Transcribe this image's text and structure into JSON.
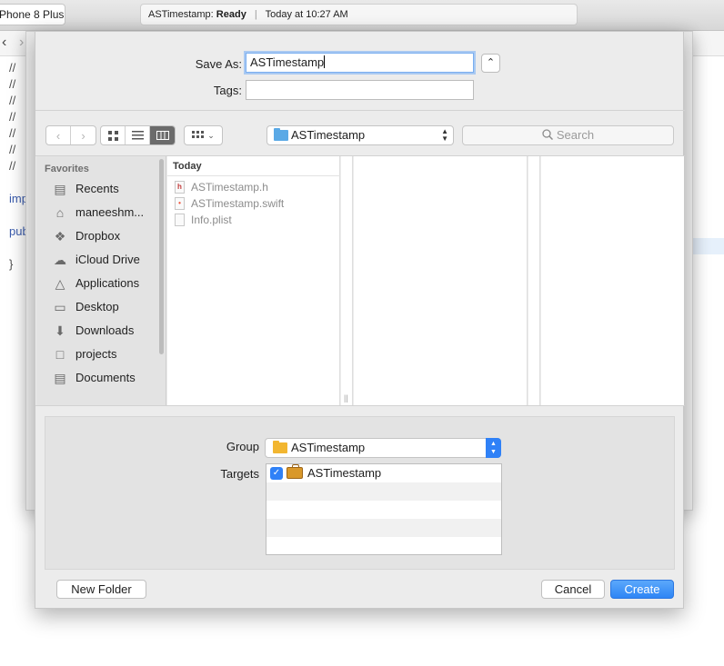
{
  "xcode": {
    "scheme": "Phone 8 Plus",
    "activity_name": "ASTimestamp:",
    "activity_status": "Ready",
    "activity_time": "Today at 10:27 AM",
    "code_lines": [
      "//",
      "//",
      "//",
      "//",
      "//",
      "//",
      "//",
      "imp",
      "pub",
      "}"
    ]
  },
  "save_as": {
    "label": "Save As:",
    "value": "ASTimestamp"
  },
  "tags": {
    "label": "Tags:",
    "value": ""
  },
  "location_popup": {
    "value": "ASTimestamp",
    "icon": "folder-icon"
  },
  "search": {
    "placeholder": "Search",
    "icon": "magnifier-icon"
  },
  "sidebar": {
    "header": "Favorites",
    "items": [
      {
        "label": "Recents",
        "icon": "clock-icon"
      },
      {
        "label": "maneeshm...",
        "icon": "home-icon"
      },
      {
        "label": "Dropbox",
        "icon": "dropbox-icon"
      },
      {
        "label": "iCloud Drive",
        "icon": "cloud-icon"
      },
      {
        "label": "Applications",
        "icon": "applications-icon"
      },
      {
        "label": "Desktop",
        "icon": "desktop-icon"
      },
      {
        "label": "Downloads",
        "icon": "downloads-icon"
      },
      {
        "label": "projects",
        "icon": "folder-icon"
      },
      {
        "label": "Documents",
        "icon": "documents-icon"
      }
    ]
  },
  "file_column": {
    "header": "Today",
    "files": [
      {
        "name": "ASTimestamp.h",
        "icon_glyph": "h"
      },
      {
        "name": "ASTimestamp.swift",
        "icon_glyph": "•"
      },
      {
        "name": "Info.plist",
        "icon_glyph": ""
      }
    ]
  },
  "group": {
    "label": "Group",
    "value": "ASTimestamp",
    "accent": "#2f81f7"
  },
  "targets": {
    "label": "Targets",
    "items": [
      {
        "label": "ASTimestamp",
        "checked": true
      }
    ]
  },
  "buttons": {
    "new_folder": "New Folder",
    "cancel": "Cancel",
    "create": "Create"
  },
  "colors": {
    "accent": "#2f81f7",
    "folder": "#5aa9e6",
    "group_folder": "#f2b630"
  }
}
